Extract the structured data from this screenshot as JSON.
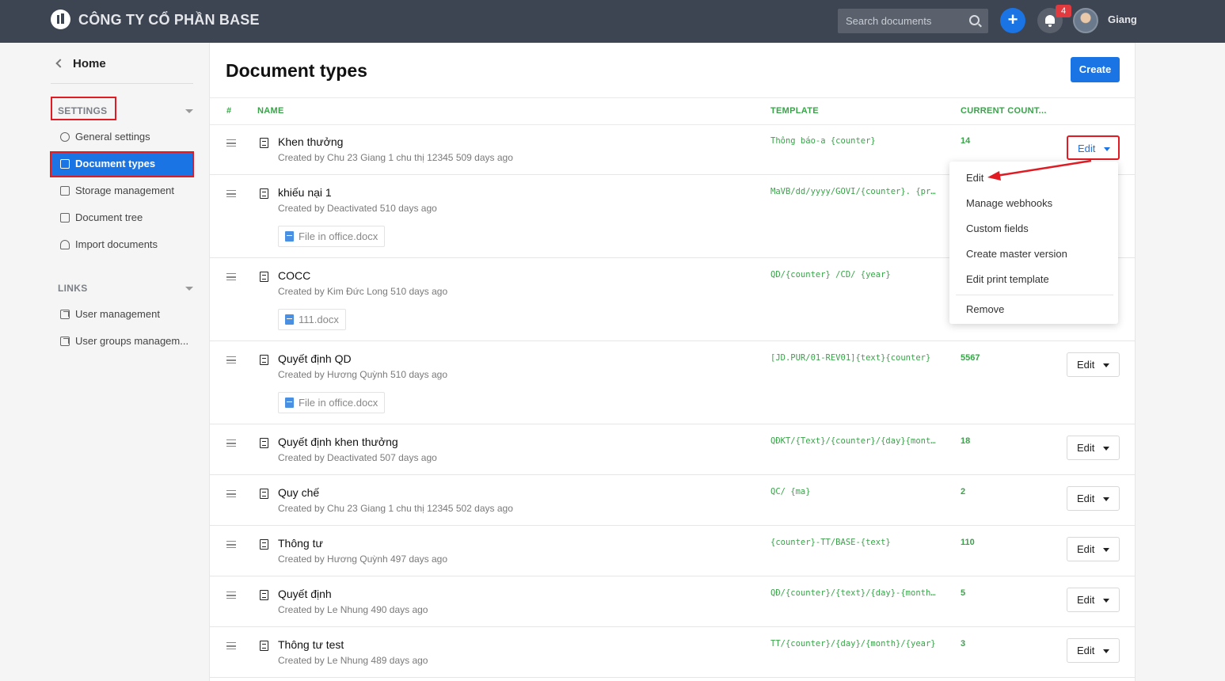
{
  "topbar": {
    "company": "CÔNG TY CỔ PHẦN BASE",
    "search_placeholder": "Search documents",
    "notification_count": "4",
    "username": "Giang"
  },
  "sidebar": {
    "home": "Home",
    "settings_heading": "SETTINGS",
    "settings_items": [
      "General settings",
      "Document types",
      "Storage management",
      "Document tree",
      "Import documents"
    ],
    "links_heading": "LINKS",
    "link_items": [
      "User management",
      "User groups managem..."
    ]
  },
  "main": {
    "title": "Document types",
    "create_label": "Create",
    "columns": {
      "index": "#",
      "name": "NAME",
      "template": "TEMPLATE",
      "count": "CURRENT COUNT..."
    },
    "edit_label": "Edit",
    "rows": [
      {
        "name": "Khen thưởng",
        "sub": "Created by Chu 23 Giang 1 chu thị 12345 509 days ago",
        "template": "Thông báo-a {counter}",
        "count": "14",
        "file": ""
      },
      {
        "name": "khiếu nại 1",
        "sub": "Created by Deactivated 510 days ago",
        "template": "MaVB/dd/yyyy/GOVI/{counter}. {pr…",
        "count": "",
        "file": "File in office.docx"
      },
      {
        "name": "COCC",
        "sub": "Created by Kim Đức Long 510 days ago",
        "template": "QD/{counter} /CD/ {year}",
        "count": "",
        "file": "111.docx"
      },
      {
        "name": "Quyết định QD",
        "sub": "Created by Hương Quỳnh 510 days ago",
        "template": "[JD.PUR/01-REV01]{text}{counter}",
        "count": "5567",
        "file": "File in office.docx"
      },
      {
        "name": "Quyết định khen thưởng",
        "sub": "Created by Deactivated 507 days ago",
        "template": "QĐKT/{Text}/{counter}/{day}{mont…",
        "count": "18",
        "file": ""
      },
      {
        "name": "Quy chế",
        "sub": "Created by Chu 23 Giang 1 chu thị 12345 502 days ago",
        "template": "QC/ {ma}",
        "count": "2",
        "file": ""
      },
      {
        "name": "Thông tư",
        "sub": "Created by Hương Quỳnh 497 days ago",
        "template": "{counter}-TT/BASE-{text}",
        "count": "110",
        "file": ""
      },
      {
        "name": "Quyết định",
        "sub": "Created by Le Nhung 490 days ago",
        "template": "QĐ/{counter}/{text}/{day}-{month…",
        "count": "5",
        "file": ""
      },
      {
        "name": "Thông tư test",
        "sub": "Created by Le Nhung 489 days ago",
        "template": "TT/{counter}/{day}/{month}/{year}",
        "count": "3",
        "file": ""
      }
    ]
  },
  "dropdown": {
    "items": [
      "Edit",
      "Manage webhooks",
      "Custom fields",
      "Create master version",
      "Edit print template",
      "Remove"
    ]
  },
  "colors": {
    "topbar": "#3d4452",
    "accent": "#1b74e4",
    "template_green": "#3aa34a",
    "highlight_red": "#e01b24"
  }
}
